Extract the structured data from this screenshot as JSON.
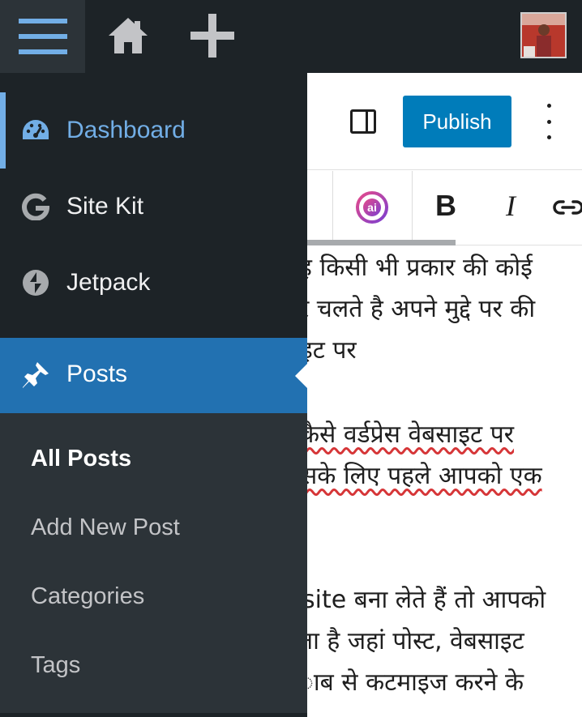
{
  "topbar": {
    "menu_icon": "hamburger-icon",
    "home_icon": "home-icon",
    "new_icon": "plus-icon",
    "avatar": "user-avatar"
  },
  "editor": {
    "header": {
      "publish_label": "Publish",
      "settings_icon": "sidebar-toggle-icon",
      "options_icon": "more-vertical-icon"
    },
    "toolbar": {
      "ai_icon": "ai-assistant-icon",
      "bold_label": "B",
      "italic_label": "I",
      "link_icon": "link-icon"
    },
    "content_lines": [
      "ह किसी भी प्रकार की कोई",
      "र चलते है अपने मुद्दे पर की",
      "इट पर",
      "कैसे वर्डप्रेस वेबसाइट पर",
      "सके लिए पहले आपको एक",
      "site बना लेते हैं तो आपको",
      "ता है जहां पोस्ट, वेबसाइट",
      "ाब से कटमाइज करने के"
    ]
  },
  "adminmenu": {
    "items": [
      {
        "label": "Dashboard",
        "icon": "dashboard-icon",
        "active": true
      },
      {
        "label": "Site Kit",
        "icon": "google-g-icon"
      },
      {
        "label": "Jetpack",
        "icon": "jetpack-icon"
      }
    ],
    "posts": {
      "label": "Posts",
      "icon": "pin-icon"
    },
    "submenu": [
      "All Posts",
      "Add New Post",
      "Categories",
      "Tags"
    ]
  },
  "colors": {
    "admin_bg": "#1d2327",
    "submenu_bg": "#2c3338",
    "active_blue": "#2271b1",
    "link_blue": "#72aee6",
    "publish_blue": "#007cba"
  }
}
